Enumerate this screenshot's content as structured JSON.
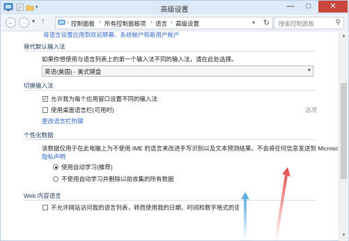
{
  "window": {
    "title": "高级设置",
    "minimize_glyph": "—",
    "maximize_glyph": "□",
    "close_glyph": "✕"
  },
  "nav": {
    "back_glyph": "←",
    "forward_glyph": "→",
    "recent_glyph": "▾",
    "up_glyph": "↑",
    "breadcrumbs": [
      "控制面板",
      "所有控制面板项",
      "语言",
      "高级设置"
    ],
    "separator": "›",
    "dropdown_glyph": "▾",
    "refresh_glyph": "↻",
    "search_placeholder": "搜索控制面板",
    "search_glyph": "⚲"
  },
  "content": {
    "top_link": "将语言设置应用到欢迎屏幕、系统帐户和新用户帐户",
    "section_default_input": {
      "heading": "替代默认输入法",
      "description": "如果你想使用与语言列表上的第一个输入法不同的输入法，请在此处选择。",
      "selected": "英语(美国) - 美式键盘"
    },
    "section_switch_input": {
      "heading": "切换输入法",
      "option1": "允许我为每个应用窗口设置不同的输入法",
      "option1_checked": true,
      "option2": "使用桌面语言栏(可用时)",
      "option2_checked": false,
      "options_link": "选项",
      "hotkeys_link": "更改语言栏热键"
    },
    "section_personalization": {
      "heading": "个性化数据",
      "description_line1": "该数据仅用于在此电脑上为不使用 IME 的语言来改进手写识别以及文本预测结果。不会将任何信息发送到 Microsoft。",
      "privacy_link": "隐私声明",
      "radio1": "使用自动学习(推荐)",
      "radio1_selected": true,
      "radio2": "不使用自动学习并删除以前收集的所有数据",
      "radio2_selected": false
    },
    "section_web": {
      "heading": "Web 内容语言",
      "option": "不允许网站访问我的语言列表，转而使用我的日期、时间和数字格式的语言作为",
      "option_checked": false
    }
  },
  "scrollbar": {
    "up_glyph": "▲",
    "down_glyph": "▼"
  },
  "colors": {
    "link": "#3366cc",
    "annotation_arrow": "#e04848",
    "annotation_arrow_blue": "#4aa3dc",
    "close_button": "#c9463d"
  }
}
